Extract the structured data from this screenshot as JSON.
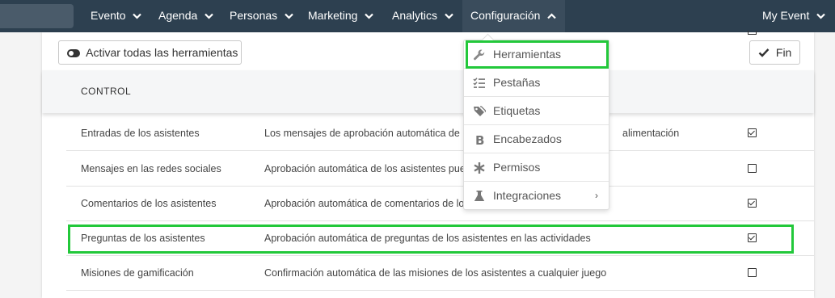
{
  "topnav": {
    "items": [
      {
        "label": "Evento"
      },
      {
        "label": "Agenda"
      },
      {
        "label": "Personas"
      },
      {
        "label": "Marketing"
      },
      {
        "label": "Analytics"
      },
      {
        "label": "Configuración"
      }
    ],
    "right_label": "My Event"
  },
  "toolbar": {
    "activate_all_label": "Activar todas las herramientas",
    "done_label": "Fin"
  },
  "table": {
    "header": "CONTROL",
    "rows": [
      {
        "control": "Entradas de los asistentes",
        "description": "Los mensajes de aprobación automática de los",
        "description_tail": "alimentación",
        "checked": true
      },
      {
        "control": "Mensajes en las redes sociales",
        "description": "Aprobación automática de los asistentes puesto",
        "checked": false
      },
      {
        "control": "Comentarios de los asistentes",
        "description": "Aprobación automática de comentarios de los a",
        "checked": true
      },
      {
        "control": "Preguntas de los asistentes",
        "description": "Aprobación automática de preguntas de los asistentes en las actividades",
        "checked": true
      },
      {
        "control": "Misiones de gamificación",
        "description": "Confirmación automática de las misiones de los asistentes a cualquier juego",
        "checked": false
      }
    ]
  },
  "dropdown": {
    "items": [
      {
        "label": "Herramientas",
        "icon": "wrench-icon"
      },
      {
        "label": "Pestañas",
        "icon": "list-check-icon"
      },
      {
        "label": "Etiquetas",
        "icon": "tags-icon"
      },
      {
        "label": "Encabezados",
        "icon": "bold-icon"
      },
      {
        "label": "Permisos",
        "icon": "asterisk-icon"
      },
      {
        "label": "Integraciones",
        "icon": "flask-icon",
        "has_submenu": true,
        "submenu_glyph": "›"
      }
    ]
  },
  "colors": {
    "nav_bg": "#2d4050",
    "highlight": "#22c83a"
  }
}
